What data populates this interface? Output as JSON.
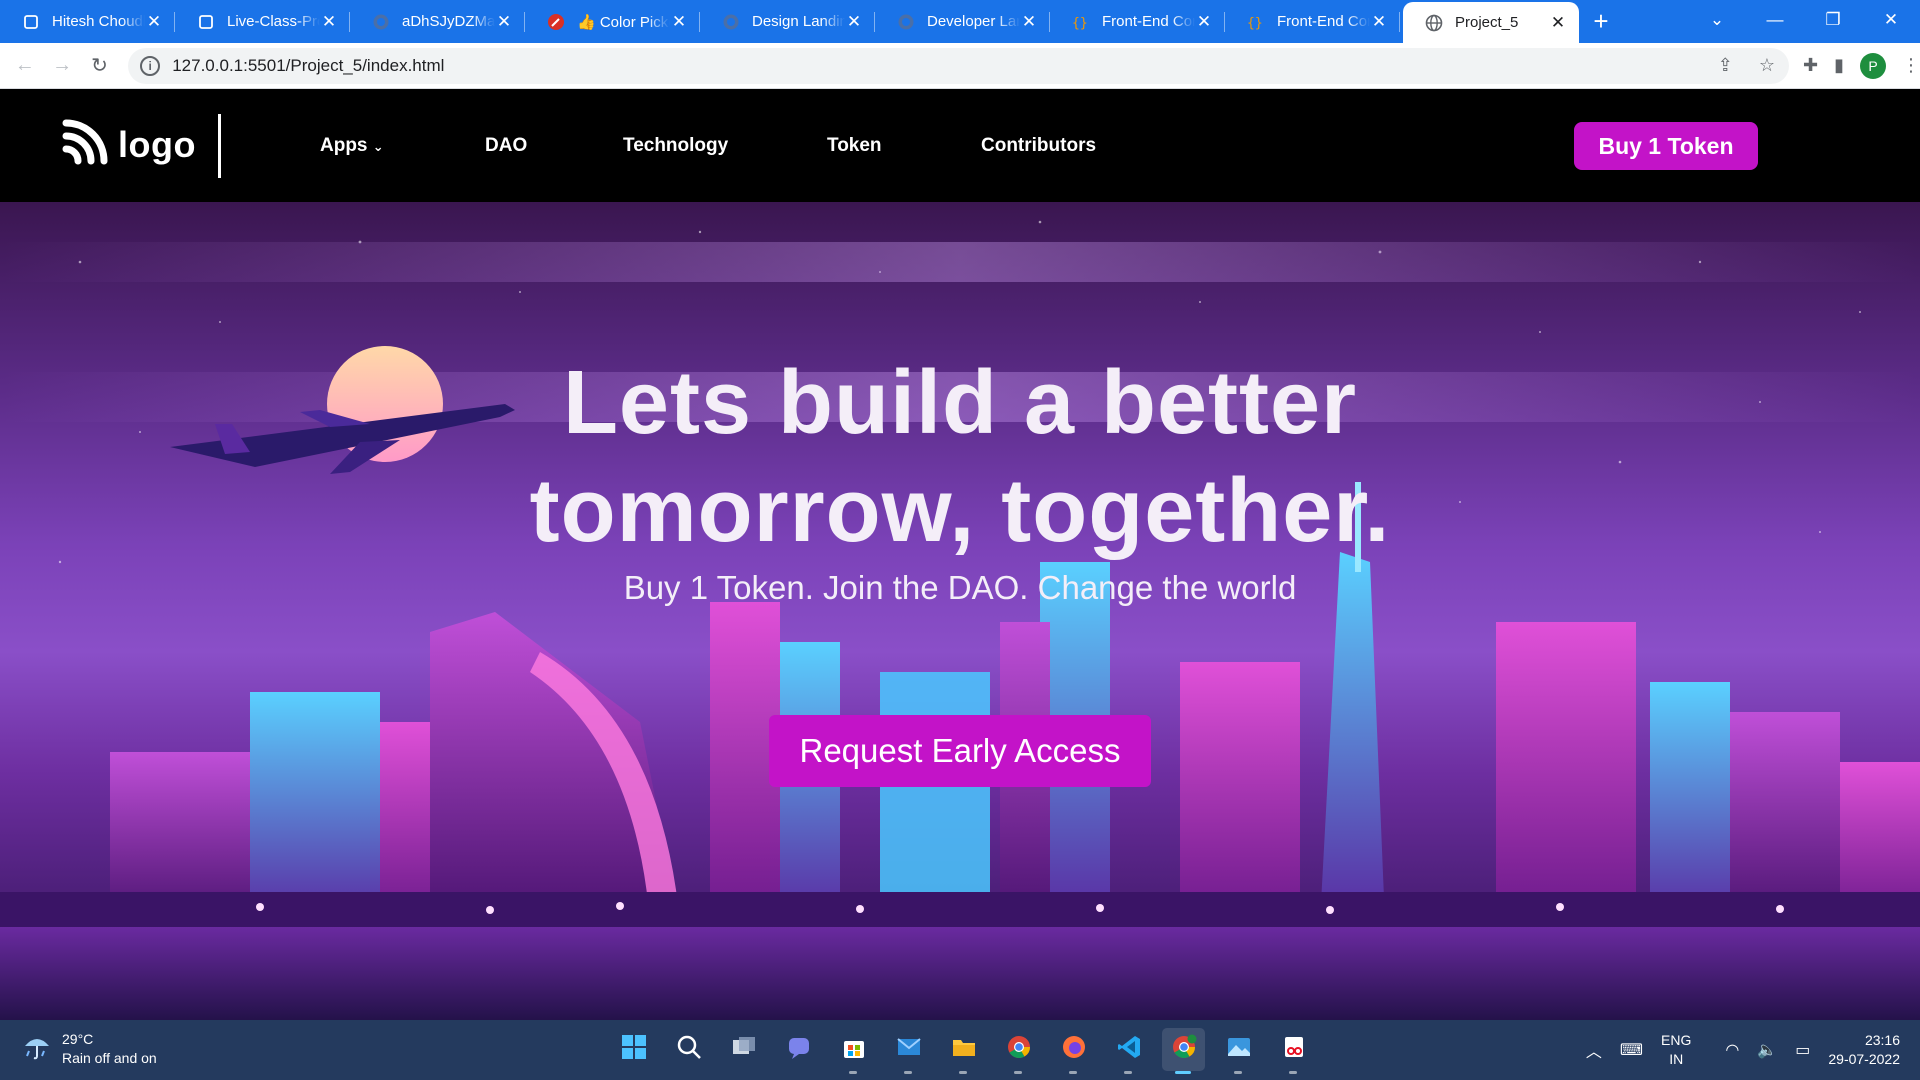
{
  "browser": {
    "tabs": [
      {
        "title": "Hitesh Choudl",
        "icon": "square-icon"
      },
      {
        "title": "Live-Class-Pro",
        "icon": "square-icon"
      },
      {
        "title": "aDhSJyDZMal",
        "icon": "github-icon"
      },
      {
        "title": "👍 Color Picke",
        "icon": "color-picker-icon"
      },
      {
        "title": "Design Landin",
        "icon": "github-icon"
      },
      {
        "title": "Developer Lan",
        "icon": "github-icon"
      },
      {
        "title": "Front-End Cor",
        "icon": "code-icon"
      },
      {
        "title": "Front-End Cor",
        "icon": "code-icon"
      }
    ],
    "active_tab": {
      "title": "Project_5",
      "icon": "globe-icon"
    },
    "url": "127.0.0.1:5501/Project_5/index.html",
    "profile_initial": "P"
  },
  "site": {
    "logo_text": "logo",
    "menu": [
      {
        "label": "Apps",
        "has_dropdown": true
      },
      {
        "label": "DAO"
      },
      {
        "label": "Technology"
      },
      {
        "label": "Token"
      },
      {
        "label": "Contributors"
      }
    ],
    "buy_button": "Buy 1 Token",
    "hero": {
      "title_line1": "Lets build a better",
      "title_line2": "tomorrow, together.",
      "subtitle": "Buy 1 Token. Join the DAO. Change the world",
      "cta": "Request Early Access"
    },
    "accent_color": "#c313c8"
  },
  "taskbar": {
    "weather_temp": "29°C",
    "weather_desc": "Rain off and on",
    "apps": [
      "windows-start-icon",
      "search-icon",
      "task-view-icon",
      "teams-chat-icon",
      "store-icon",
      "mail-icon",
      "file-explorer-icon",
      "chrome-icon",
      "firefox-icon",
      "vscode-icon",
      "chrome-profile-icon",
      "photos-icon",
      "snipping-tool-icon"
    ],
    "lang_top": "ENG",
    "lang_bottom": "IN",
    "time": "23:16",
    "date": "29-07-2022"
  }
}
